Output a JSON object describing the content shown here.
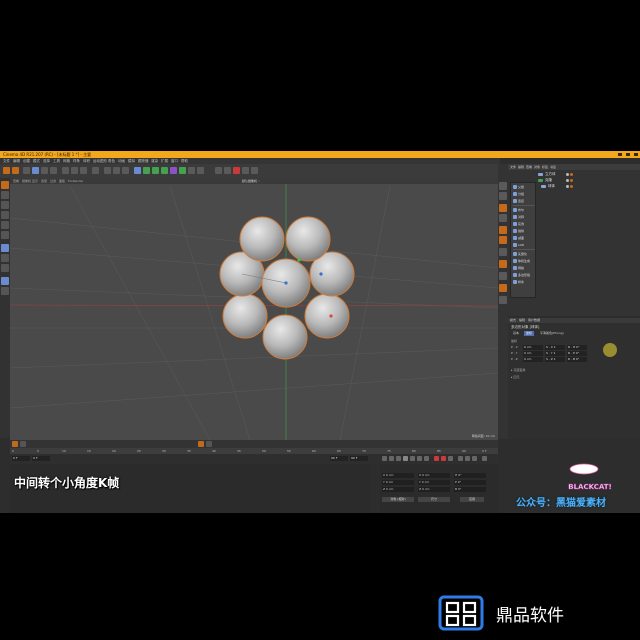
{
  "window": {
    "title": "Cinema 4D R21.207 (RC) - [未标题 1 *] - 主要"
  },
  "menu": {
    "items": [
      "文件",
      "编辑",
      "创建",
      "模式",
      "选择",
      "工具",
      "网格",
      "样条",
      "体积",
      "运动图形",
      "角色",
      "动画",
      "模拟",
      "跟踪器",
      "渲染",
      "扩展",
      "窗口",
      "帮助"
    ]
  },
  "viewport": {
    "menu": [
      "查看",
      "摄像机",
      "显示",
      "选项",
      "过滤",
      "面板",
      "ProRender"
    ],
    "camera_label": "默认摄像机 ◦",
    "grid_label": "网格间距: 10 cm"
  },
  "object_manager": {
    "tabs": [
      "文件",
      "编辑",
      "查看",
      "对象",
      "标签",
      "书签"
    ],
    "objects": [
      {
        "name": "立方体"
      },
      {
        "name": "克隆"
      },
      {
        "name": "球体"
      }
    ]
  },
  "dropdown": {
    "items": [
      "父级",
      "分组",
      "连接",
      "布尔",
      "对称",
      "实例",
      "融球",
      "减面",
      "LOD",
      "矢量化",
      "体积生成",
      "网格",
      "多边形组",
      "样条"
    ]
  },
  "attributes": {
    "tabs": [
      "模式",
      "编辑",
      "用户数据"
    ],
    "title": "多边形对象 [球体]",
    "subtabs": [
      "基本",
      "坐标",
      "平滑着色(Phong)"
    ],
    "section": "坐标",
    "rows": [
      {
        "label": "P . X",
        "v1": "0 cm",
        "v2": "S . X 1",
        "v3": "R . H 0°"
      },
      {
        "label": "P . Y",
        "v1": "0 cm",
        "v2": "S . Y 1",
        "v3": "R . P 0°"
      },
      {
        "label": "P . Z",
        "v1": "0 cm",
        "v2": "S . Z 1",
        "v3": "R . B 0°"
      }
    ],
    "folds": [
      "▸ 冻结变换",
      "▸ 四元"
    ]
  },
  "timeline": {
    "ticks": [
      "0",
      "5",
      "10",
      "15",
      "20",
      "25",
      "30",
      "35",
      "40",
      "45",
      "50",
      "55",
      "60",
      "65",
      "70",
      "75",
      "80",
      "85",
      "90"
    ],
    "end_label": "0 F"
  },
  "transport": {
    "start": "0 F",
    "current": "0 F",
    "end": "90 F",
    "end2": "90 F"
  },
  "coordinates": {
    "fields": [
      "X 0 cm",
      "X 0 cm",
      "H 0°",
      "Y 0 cm",
      "Y 0 cm",
      "P 0°",
      "Z 0 cm",
      "Z 0 cm",
      "B 0°"
    ],
    "mode": "对象 (相对)",
    "size": "尺寸",
    "apply": "应用"
  },
  "overlay": {
    "subtitle": "中间转个小角度K帧",
    "watermark_brand": "BLACKCAT!",
    "watermark_account": "公众号：黑猫爱素材",
    "app_brand": "鼎品软件"
  },
  "colors": {
    "titlebar": "#f3a71c",
    "viewport_bg": "#4a4a4a",
    "selection": "#e07b30",
    "brand_blue": "#2f7be8"
  }
}
